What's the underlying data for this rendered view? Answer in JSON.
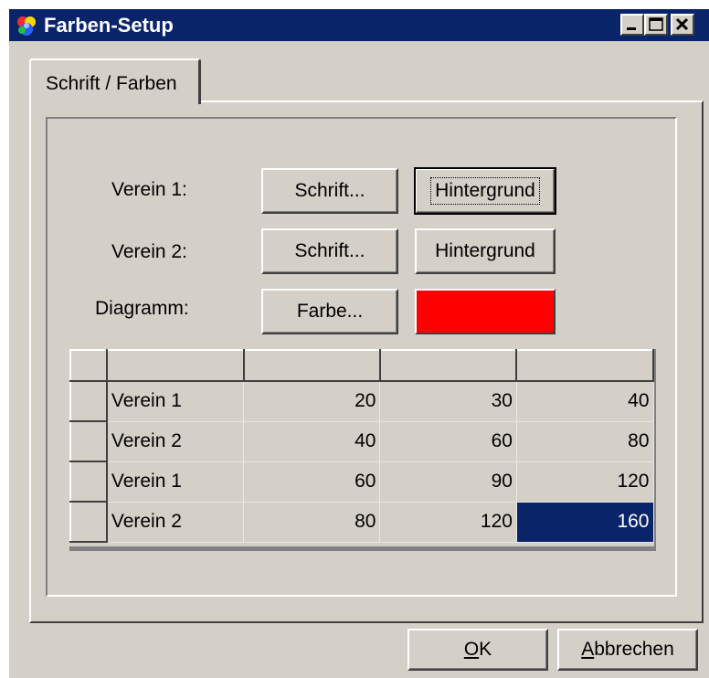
{
  "window": {
    "title": "Farben-Setup",
    "icon": "palette-icon"
  },
  "tabs": [
    {
      "label": "Schrift / Farben",
      "active": true
    }
  ],
  "rows": {
    "verein1": {
      "label": "Verein 1:",
      "font_button": "Schrift...",
      "background_button": "Hintergrund"
    },
    "verein2": {
      "label": "Verein 2:",
      "font_button": "Schrift...",
      "background_button": "Hintergrund"
    },
    "diagramm": {
      "label": "Diagramm:",
      "color_button": "Farbe...",
      "color_value": "#ff0000"
    }
  },
  "grid": {
    "headers": [
      "",
      "",
      "",
      ""
    ],
    "rows": [
      {
        "name": "Verein 1",
        "values": [
          "20",
          "30",
          "40"
        ]
      },
      {
        "name": "Verein 2",
        "values": [
          "40",
          "60",
          "80"
        ]
      },
      {
        "name": "Verein 1",
        "values": [
          "60",
          "90",
          "120"
        ]
      },
      {
        "name": "Verein 2",
        "values": [
          "80",
          "120",
          "160"
        ]
      }
    ],
    "selected_cell": {
      "row": 3,
      "col": 3
    }
  },
  "footer": {
    "ok_accel": "O",
    "ok_rest": "K",
    "cancel_accel": "A",
    "cancel_rest": "bbrechen"
  },
  "colors": {
    "titlebar": "#0a246a",
    "face": "#d4d0c8",
    "selection": "#0a246a",
    "diagram_color": "#ff0000"
  }
}
